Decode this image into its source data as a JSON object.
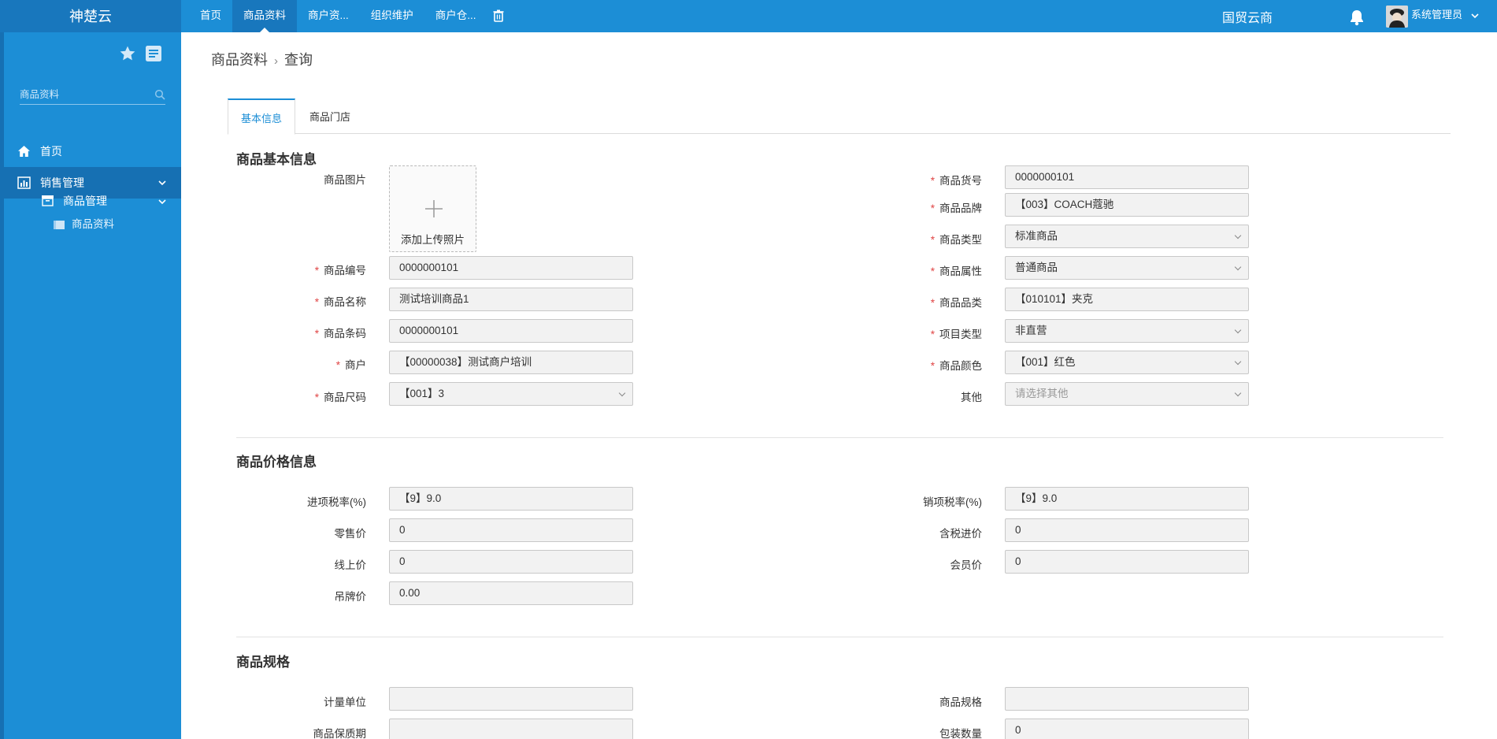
{
  "app": {
    "brand": "神楚云",
    "org_name": "国贸云商",
    "user_name": "系统管理员"
  },
  "topnav": [
    "首页",
    "商品资料",
    "商户资...",
    "组织维护",
    "商户仓..."
  ],
  "sidebar": {
    "search_placeholder": "商品资料",
    "menu": {
      "home": "首页",
      "sales": "销售管理",
      "goods_mgmt": "商品管理",
      "goods_data": "商品资料"
    }
  },
  "breadcrumb": [
    "商品资料",
    "查询"
  ],
  "tabs": [
    "基本信息",
    "商品门店"
  ],
  "sections": {
    "basic": "商品基本信息",
    "price": "商品价格信息",
    "spec": "商品规格"
  },
  "upload": {
    "label": "商品图片",
    "text": "添加上传照片"
  },
  "basic_left": [
    {
      "label": "商品编号",
      "value": "0000000101",
      "required": "*"
    },
    {
      "label": "商品名称",
      "value": "测试培训商品1",
      "required": "*"
    },
    {
      "label": "商品条码",
      "value": "0000000101",
      "required": "*"
    },
    {
      "label": "商户",
      "value": "【00000038】测试商户培训",
      "required": "*"
    },
    {
      "label": "商品尺码",
      "value": "【001】3",
      "required": "*"
    }
  ],
  "basic_right": [
    {
      "label": "商品货号",
      "value": "0000000101",
      "required": "*"
    },
    {
      "label": "商品品牌",
      "value": "【003】COACH蔻驰",
      "required": "*"
    },
    {
      "label": "商品类型",
      "value": "标准商品",
      "required": "*"
    },
    {
      "label": "商品属性",
      "value": "普通商品",
      "required": "*"
    },
    {
      "label": "商品品类",
      "value": "【010101】夹克",
      "required": "*"
    },
    {
      "label": "项目类型",
      "value": "非直营",
      "required": "*"
    },
    {
      "label": "商品颜色",
      "value": "【001】红色",
      "required": "*"
    },
    {
      "label": "其他",
      "placeholder": "请选择其他"
    }
  ],
  "price_left": [
    {
      "label": "进项税率(%)",
      "value": "【9】9.0"
    },
    {
      "label": "零售价",
      "value": "0"
    },
    {
      "label": "线上价",
      "value": "0"
    },
    {
      "label": "吊牌价",
      "value": "0.00"
    }
  ],
  "price_right": [
    {
      "label": "销项税率(%)",
      "value": "【9】9.0"
    },
    {
      "label": "含税进价",
      "value": "0"
    },
    {
      "label": "会员价",
      "value": "0"
    }
  ],
  "spec_left": [
    {
      "label": "计量单位",
      "value": ""
    },
    {
      "label": "商品保质期",
      "value": ""
    }
  ],
  "spec_right": [
    {
      "label": "商品规格",
      "value": ""
    },
    {
      "label": "包装数量",
      "value": "0"
    }
  ]
}
